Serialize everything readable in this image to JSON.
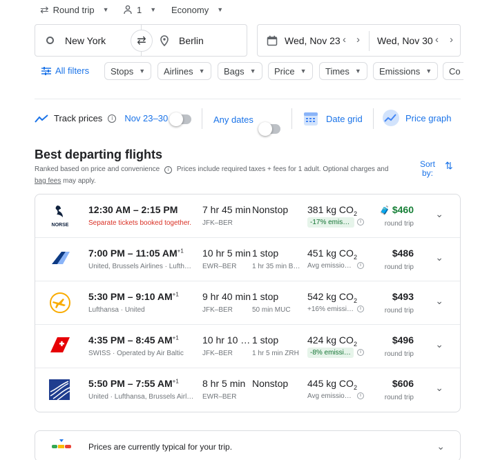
{
  "trip": {
    "type": "Round trip",
    "passengers": "1",
    "cabin": "Economy"
  },
  "search": {
    "origin": "New York",
    "destination": "Berlin",
    "depart_date": "Wed, Nov 23",
    "return_date": "Wed, Nov 30"
  },
  "filters": {
    "all_filters": "All filters",
    "items": [
      "Stops",
      "Airlines",
      "Bags",
      "Price",
      "Times",
      "Emissions",
      "Co"
    ]
  },
  "tools": {
    "track_prices": "Track prices",
    "track_range": "Nov 23–30",
    "any_dates": "Any dates",
    "date_grid": "Date grid",
    "price_graph": "Price graph"
  },
  "section": {
    "title": "Best departing flights",
    "subtitle_part1": "Ranked based on price and convenience",
    "subtitle_part2": "Prices include required taxes + fees for 1 adult. Optional charges and",
    "bag_fees": "bag fees",
    "subtitle_part3": "may apply.",
    "sort_label_1": "Sort",
    "sort_label_2": "by:"
  },
  "flights": [
    {
      "logo": "norse-logo",
      "logo_text": "NORSE",
      "times": "12:30 AM – 2:15 PM",
      "plus_day": "",
      "airline": "Separate tickets booked together.",
      "airline_warning": true,
      "duration": "7 hr 45 min",
      "route": "JFK–BER",
      "stops": "Nonstop",
      "layover": "",
      "co2": "381 kg CO",
      "co2_sub": "2",
      "emissions": "-17% emiss…",
      "emissions_style": "green",
      "price": "$460",
      "price_green": true,
      "price_note": "round trip",
      "price_icon": true
    },
    {
      "logo": "brussels-logo",
      "logo_text": "",
      "times": "7:00 PM – 11:05 AM",
      "plus_day": "+1",
      "airline": "United, Brussels Airlines · Lufth…",
      "airline_warning": false,
      "duration": "10 hr 5 min",
      "route": "EWR–BER",
      "stops": "1 stop",
      "layover": "1 hr 35 min B…",
      "co2": "451 kg CO",
      "co2_sub": "2",
      "emissions": "Avg emissio…",
      "emissions_style": "plain",
      "price": "$486",
      "price_green": false,
      "price_note": "round trip",
      "price_icon": false
    },
    {
      "logo": "lufthansa-logo",
      "logo_text": "",
      "times": "5:30 PM – 9:10 AM",
      "plus_day": "+1",
      "airline": "Lufthansa · United",
      "airline_warning": false,
      "duration": "9 hr 40 min",
      "route": "JFK–BER",
      "stops": "1 stop",
      "layover": "50 min MUC",
      "co2": "542 kg CO",
      "co2_sub": "2",
      "emissions": "+16% emissi…",
      "emissions_style": "plain",
      "price": "$493",
      "price_green": false,
      "price_note": "round trip",
      "price_icon": false
    },
    {
      "logo": "swiss-logo",
      "logo_text": "",
      "times": "4:35 PM – 8:45 AM",
      "plus_day": "+1",
      "airline": "SWISS · Operated by Air Baltic",
      "airline_warning": false,
      "duration": "10 hr 10 m…",
      "route": "JFK–BER",
      "stops": "1 stop",
      "layover": "1 hr 5 min ZRH",
      "co2": "424 kg CO",
      "co2_sub": "2",
      "emissions": "-8% emissi…",
      "emissions_style": "green",
      "price": "$496",
      "price_green": false,
      "price_note": "round trip",
      "price_icon": false
    },
    {
      "logo": "united-logo",
      "logo_text": "",
      "times": "5:50 PM – 7:55 AM",
      "plus_day": "+1",
      "airline": "United · Lufthansa, Brussels Airl…",
      "airline_warning": false,
      "duration": "8 hr 5 min",
      "route": "EWR–BER",
      "stops": "Nonstop",
      "layover": "",
      "co2": "445 kg CO",
      "co2_sub": "2",
      "emissions": "Avg emissio…",
      "emissions_style": "plain",
      "price": "$606",
      "price_green": false,
      "price_note": "round trip",
      "price_icon": false
    }
  ],
  "insight": {
    "text": "Prices are currently typical for your trip."
  },
  "colors": {
    "accent": "#1a73e8",
    "green": "#188038",
    "warning": "#d93025"
  }
}
